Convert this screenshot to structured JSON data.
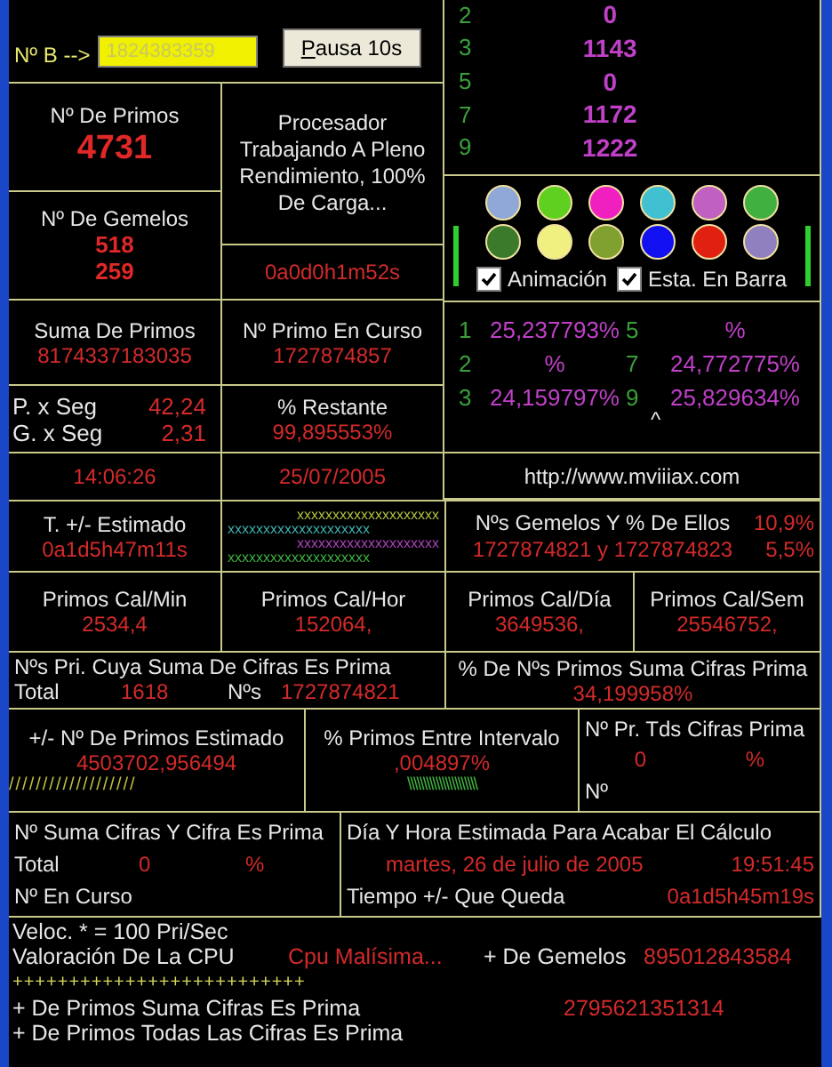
{
  "input_row": {
    "label": "Nº B -->",
    "value": "1824383359",
    "button": "Pausa 10s"
  },
  "digit_counts": [
    {
      "digit": "2",
      "count": "0"
    },
    {
      "digit": "3",
      "count": "1143"
    },
    {
      "digit": "5",
      "count": "0"
    },
    {
      "digit": "7",
      "count": "1172"
    },
    {
      "digit": "9",
      "count": "1222"
    }
  ],
  "primes_count": {
    "label": "Nº De Primos",
    "value": "4731"
  },
  "status_message": "Procesador Trabajando A Pleno Rendimiento, 100% De Carga...",
  "twins_count": {
    "label": "Nº De Gemelos",
    "values": [
      "518",
      "259"
    ]
  },
  "elapsed": "0a0d0h1m52s",
  "swatches": [
    {
      "color": "#8fa8d8"
    },
    {
      "color": "#60d020"
    },
    {
      "color": "#f020c0"
    },
    {
      "color": "#40c0d0"
    },
    {
      "color": "#c060c0"
    },
    {
      "color": "#40b040"
    },
    {
      "color": "#3a7a2a"
    },
    {
      "color": "#f0f080"
    },
    {
      "color": "#80a030"
    },
    {
      "color": "#1010f0"
    },
    {
      "color": "#e02010"
    },
    {
      "color": "#9080c0"
    }
  ],
  "options": [
    {
      "label": "Animación",
      "checked": true
    },
    {
      "label": "Esta. En Barra",
      "checked": true
    }
  ],
  "sum_primes": {
    "label": "Suma De Primos",
    "value": "8174337183035"
  },
  "current_prime": {
    "label": "Nº Primo En Curso",
    "value": "1727874857"
  },
  "digit_percents": [
    {
      "digit": "1",
      "value": "25,237793%"
    },
    {
      "digit": "5",
      "value": "%"
    },
    {
      "digit": "2",
      "value": "%"
    },
    {
      "digit": "7",
      "value": "24,772775%"
    },
    {
      "digit": "3",
      "value": "24,159797%"
    },
    {
      "digit": "9",
      "value": "25,829634%"
    }
  ],
  "percent_marker": "^",
  "rates": [
    {
      "label": "P. x Seg",
      "value": "42,24"
    },
    {
      "label": "G. x Seg",
      "value": "2,31"
    }
  ],
  "remaining": {
    "label": "% Restante",
    "value": "99,895553%"
  },
  "clock": "14:06:26",
  "date": "25/07/2005",
  "url": "http://www.mviiiax.com",
  "estimated_time": {
    "label": "T. +/- Estimado",
    "value": "0a1d5h47m11s"
  },
  "x_lines": [
    {
      "text": "xxxxxxxxxxxxxxxxxxxx",
      "color": "#b0c040",
      "kind": "shifted"
    },
    {
      "text": "xxxxxxxxxxxxxxxxxxxx",
      "color": "#40b0b0",
      "kind": "flush"
    },
    {
      "text": "xxxxxxxxxxxxxxxxxxxx",
      "color": "#b040c0",
      "kind": "shifted"
    },
    {
      "text": "xxxxxxxxxxxxxxxxxxxx",
      "color": "#40b040",
      "kind": "flush"
    }
  ],
  "twins": {
    "label": "Nºs Gemelos Y % De Ellos",
    "value": "1727874821 y 1727874823",
    "percents": [
      "10,9%",
      "5,5%"
    ]
  },
  "per_time": [
    {
      "label": "Primos Cal/Min",
      "value": "2534,4"
    },
    {
      "label": "Primos Cal/Hor",
      "value": "152064,"
    },
    {
      "label": "Primos Cal/Día",
      "value": "3649536,"
    },
    {
      "label": "Primos Cal/Sem",
      "value": "25546752,"
    }
  ],
  "digit_sum_prime": {
    "label": "Nºs Pri. Cuya Suma De Cifras Es Prima",
    "total_label": "Total",
    "total": "1618",
    "number_label": "Nºs",
    "number": "1727874821"
  },
  "digit_sum_percent": {
    "label": "% De Nºs Primos Suma Cifras Prima",
    "value": "34,199958%"
  },
  "estimated_primes": {
    "label": "+/- Nº De Primos Estimado",
    "value": "4503702,956494",
    "bar": "///////////////////"
  },
  "interval_percent": {
    "label": "% Primos Entre Intervalo",
    "value": ",004897%",
    "bar": "\\\\\\\\\\\\\\\\\\\\\\\\\\\\\\\\\\\\\\\\\\\\"
  },
  "all_digits_prime": {
    "label": "Nº Pr. Tds Cifras Prima",
    "value": "0",
    "percent": "%",
    "number_label": "Nº"
  },
  "sum_and_digit": {
    "label": "Nº Suma Cifras Y Cifra Es Prima",
    "total_label": "Total",
    "total": "0",
    "percent": "%",
    "current_label": "Nº En Curso"
  },
  "finish": {
    "label": "Día Y Hora Estimada Para Acabar El Cálculo",
    "date": "martes, 26 de julio de 2005",
    "time": "19:51:45",
    "left_label": "Tiempo +/- Que Queda",
    "left": "0a1d5h45m19s"
  },
  "speed_note": "Veloc. * = 100 Pri/Sec",
  "cpu": {
    "label": "Valoración De La CPU",
    "value": "Cpu Malísima...",
    "twins_label": "+ De Gemelos",
    "twins_value": "895012843584"
  },
  "plus_line": "++++++++++++++++++++++++++",
  "records": [
    {
      "label": "+ De Primos Suma Cifras Es Prima",
      "value": "2795621351314"
    },
    {
      "label": "+ De Primos Todas Las Cifras Es Prima"
    }
  ]
}
